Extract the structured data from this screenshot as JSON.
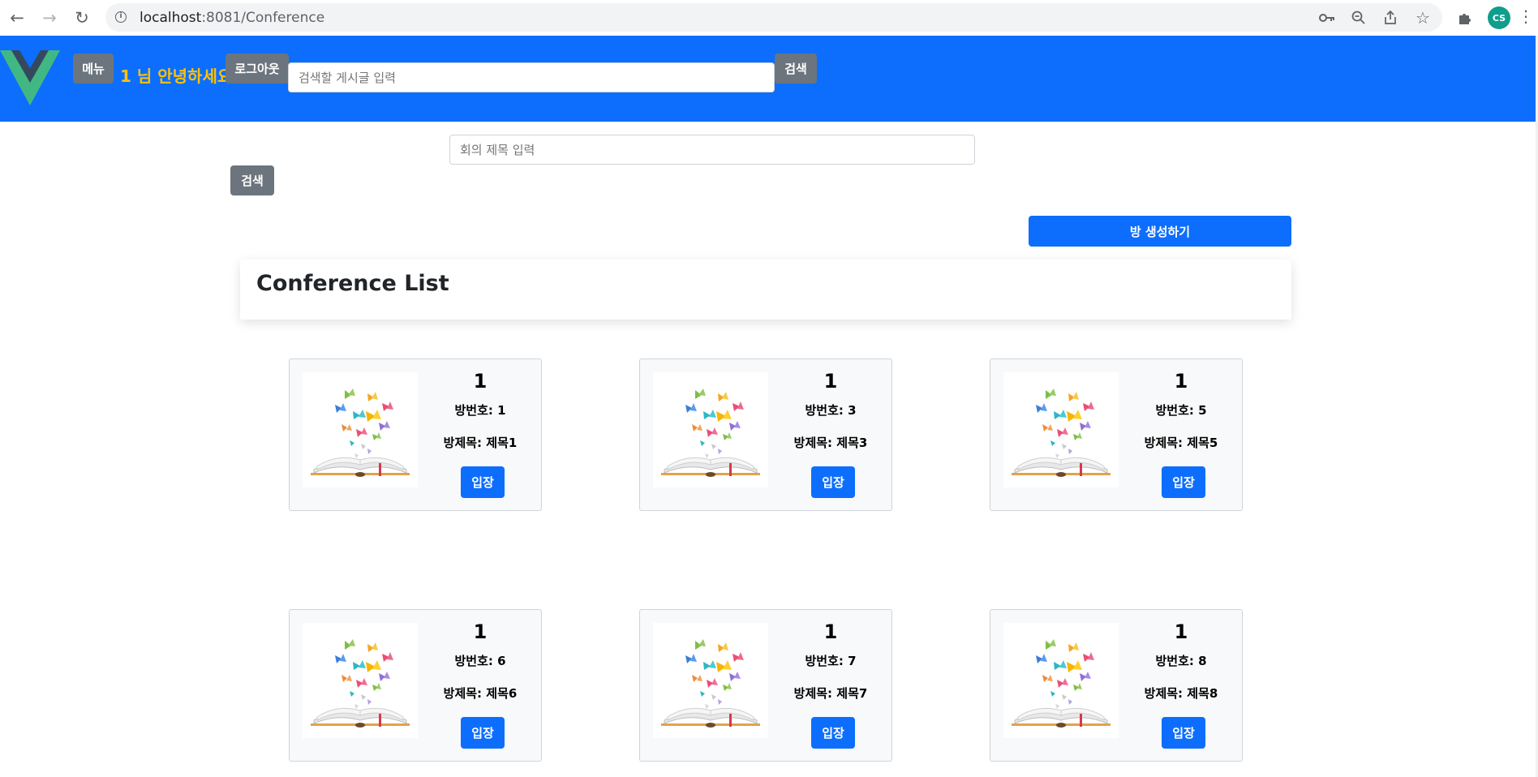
{
  "browser": {
    "url_host": "localhost",
    "url_rest": ":8081/Conference",
    "profile_initials": "CS"
  },
  "header": {
    "menu_label": "메뉴",
    "greeting": "1 님 안녕하세요",
    "logout_label": "로그아웃",
    "search_placeholder": "검색할 게시글 입력",
    "search_button": "검색",
    "brand_colors": {
      "bar": "#0d6efd",
      "greeting": "#ffc107",
      "logo_outer": "#41b883",
      "logo_inner": "#35495e"
    }
  },
  "conference": {
    "search_placeholder": "회의 제목 입력",
    "search_button": "검색",
    "create_button": "방 생성하기",
    "list_title": "Conference List",
    "rooms": [
      {
        "count": "1",
        "room_no": "방번호: 1",
        "title": "방제목: 제목1",
        "enter": "입장"
      },
      {
        "count": "1",
        "room_no": "방번호: 3",
        "title": "방제목: 제목3",
        "enter": "입장"
      },
      {
        "count": "1",
        "room_no": "방번호: 5",
        "title": "방제목: 제목5",
        "enter": "입장"
      },
      {
        "count": "1",
        "room_no": "방번호: 6",
        "title": "방제목: 제목6",
        "enter": "입장"
      },
      {
        "count": "1",
        "room_no": "방번호: 7",
        "title": "방제목: 제목7",
        "enter": "입장"
      },
      {
        "count": "1",
        "room_no": "방번호: 8",
        "title": "방제목: 제목8",
        "enter": "입장"
      }
    ]
  }
}
